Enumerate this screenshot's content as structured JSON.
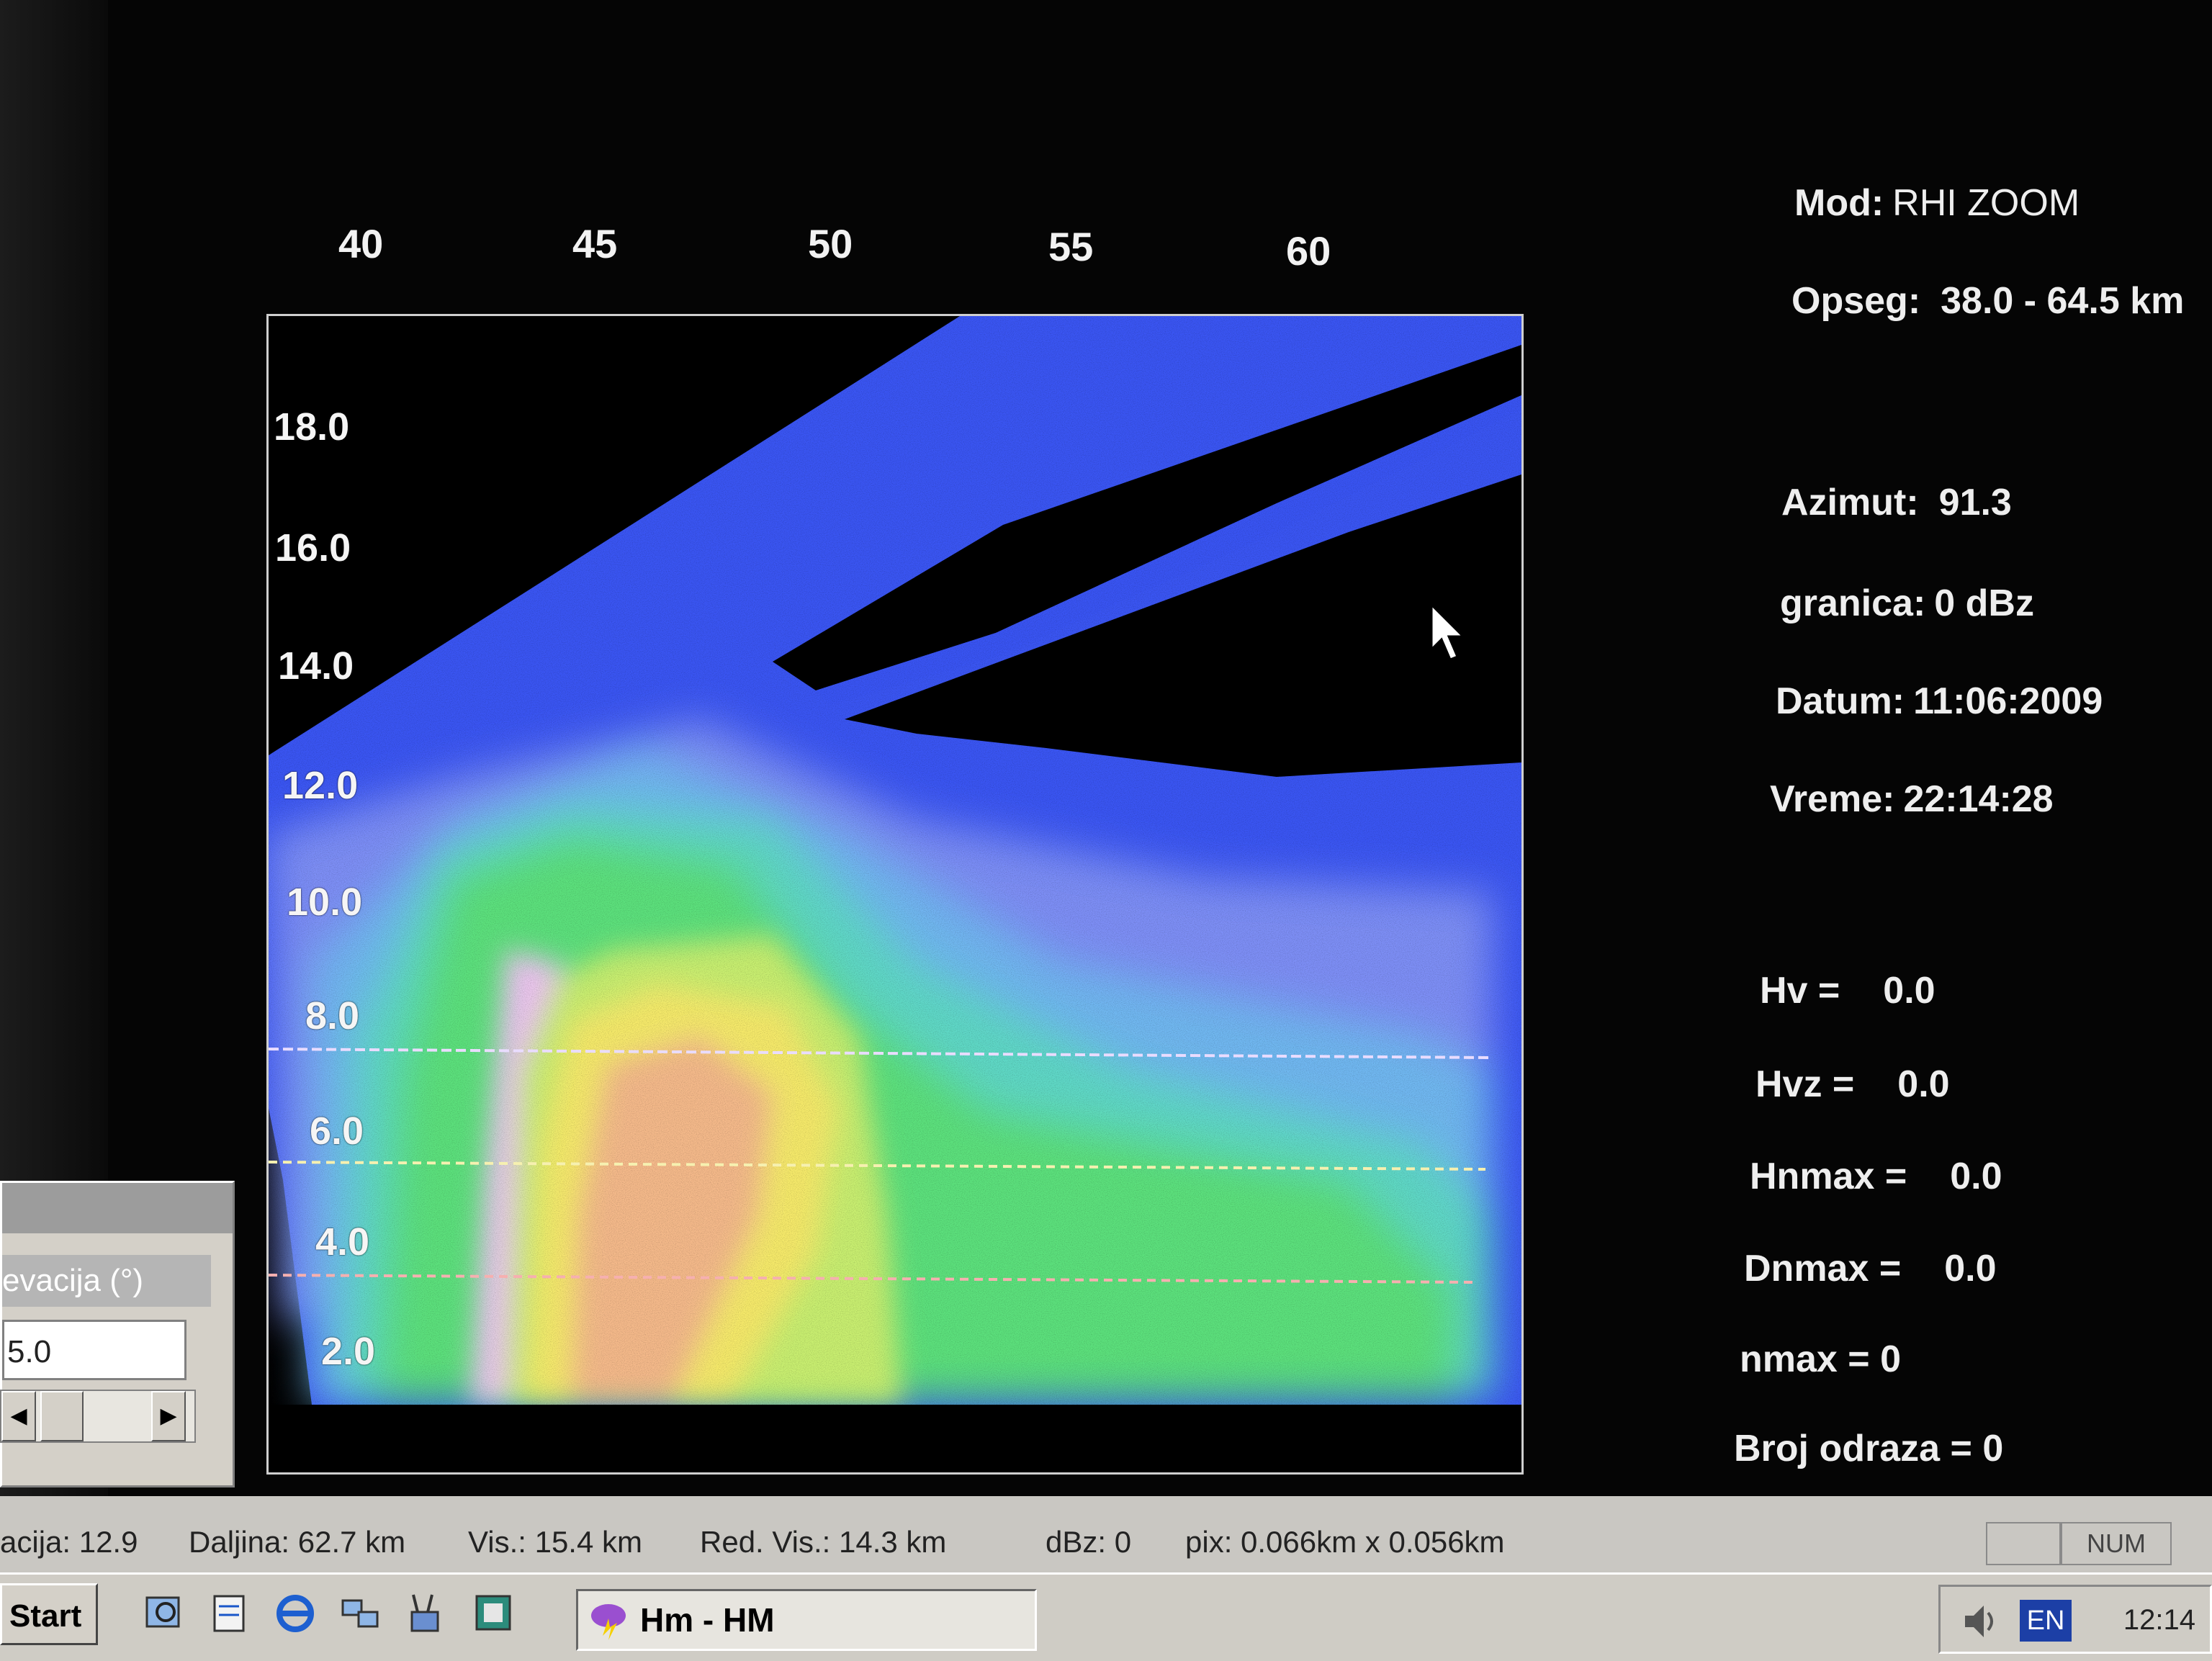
{
  "plot": {
    "x_ticks": [
      "40",
      "45",
      "50",
      "55",
      "60"
    ],
    "y_ticks": [
      "18.0",
      "16.0",
      "14.0",
      "12.0",
      "10.0",
      "8.0",
      "6.0",
      "4.0",
      "2.0"
    ]
  },
  "info": {
    "mod_label": "Mod:",
    "mod_value": "RHI ZOOM",
    "opseg_label": "Opseg:",
    "opseg_value": "38.0 -  64.5 km",
    "azimut_label": "Azimut:",
    "azimut_value": "91.3",
    "granica_label": "granica:",
    "granica_value": "0 dBz",
    "datum_label": "Datum:",
    "datum_value": "11:06:2009",
    "vreme_label": "Vreme:",
    "vreme_value": "22:14:28",
    "hv_label": "Hv =",
    "hv_value": "0.0",
    "hvz_label": "Hvz =",
    "hvz_value": "0.0",
    "hnmax_label": "Hnmax =",
    "hnmax_value": "0.0",
    "dnmax_label": "Dnmax =",
    "dnmax_value": "0.0",
    "nmax_text": "nmax = 0",
    "broj_text": "Broj odraza = 0"
  },
  "panel": {
    "label": "evacija (°)",
    "input_value": "5.0",
    "scroll_left": "◀",
    "scroll_right": "▶"
  },
  "statusbar": {
    "elevacija": "acija:   12.9",
    "daljina": "Daljina:   62.7 km",
    "vis": "Vis.:   15.4 km",
    "red_vis": "Red. Vis.:   14.3 km",
    "dbz": "dBz:   0",
    "pix": "pix:  0.066km x  0.056km",
    "num": "NUM"
  },
  "taskbar": {
    "start_label": "Start",
    "task_label": "Hm - HM",
    "lang": "EN",
    "clock": "12:14"
  },
  "colors": {
    "background": "#050505",
    "echo_low": "#3a4cff",
    "echo_mid": "#3fd7a0",
    "echo_high": "#f5e96a",
    "echo_peak": "#f29a78"
  }
}
